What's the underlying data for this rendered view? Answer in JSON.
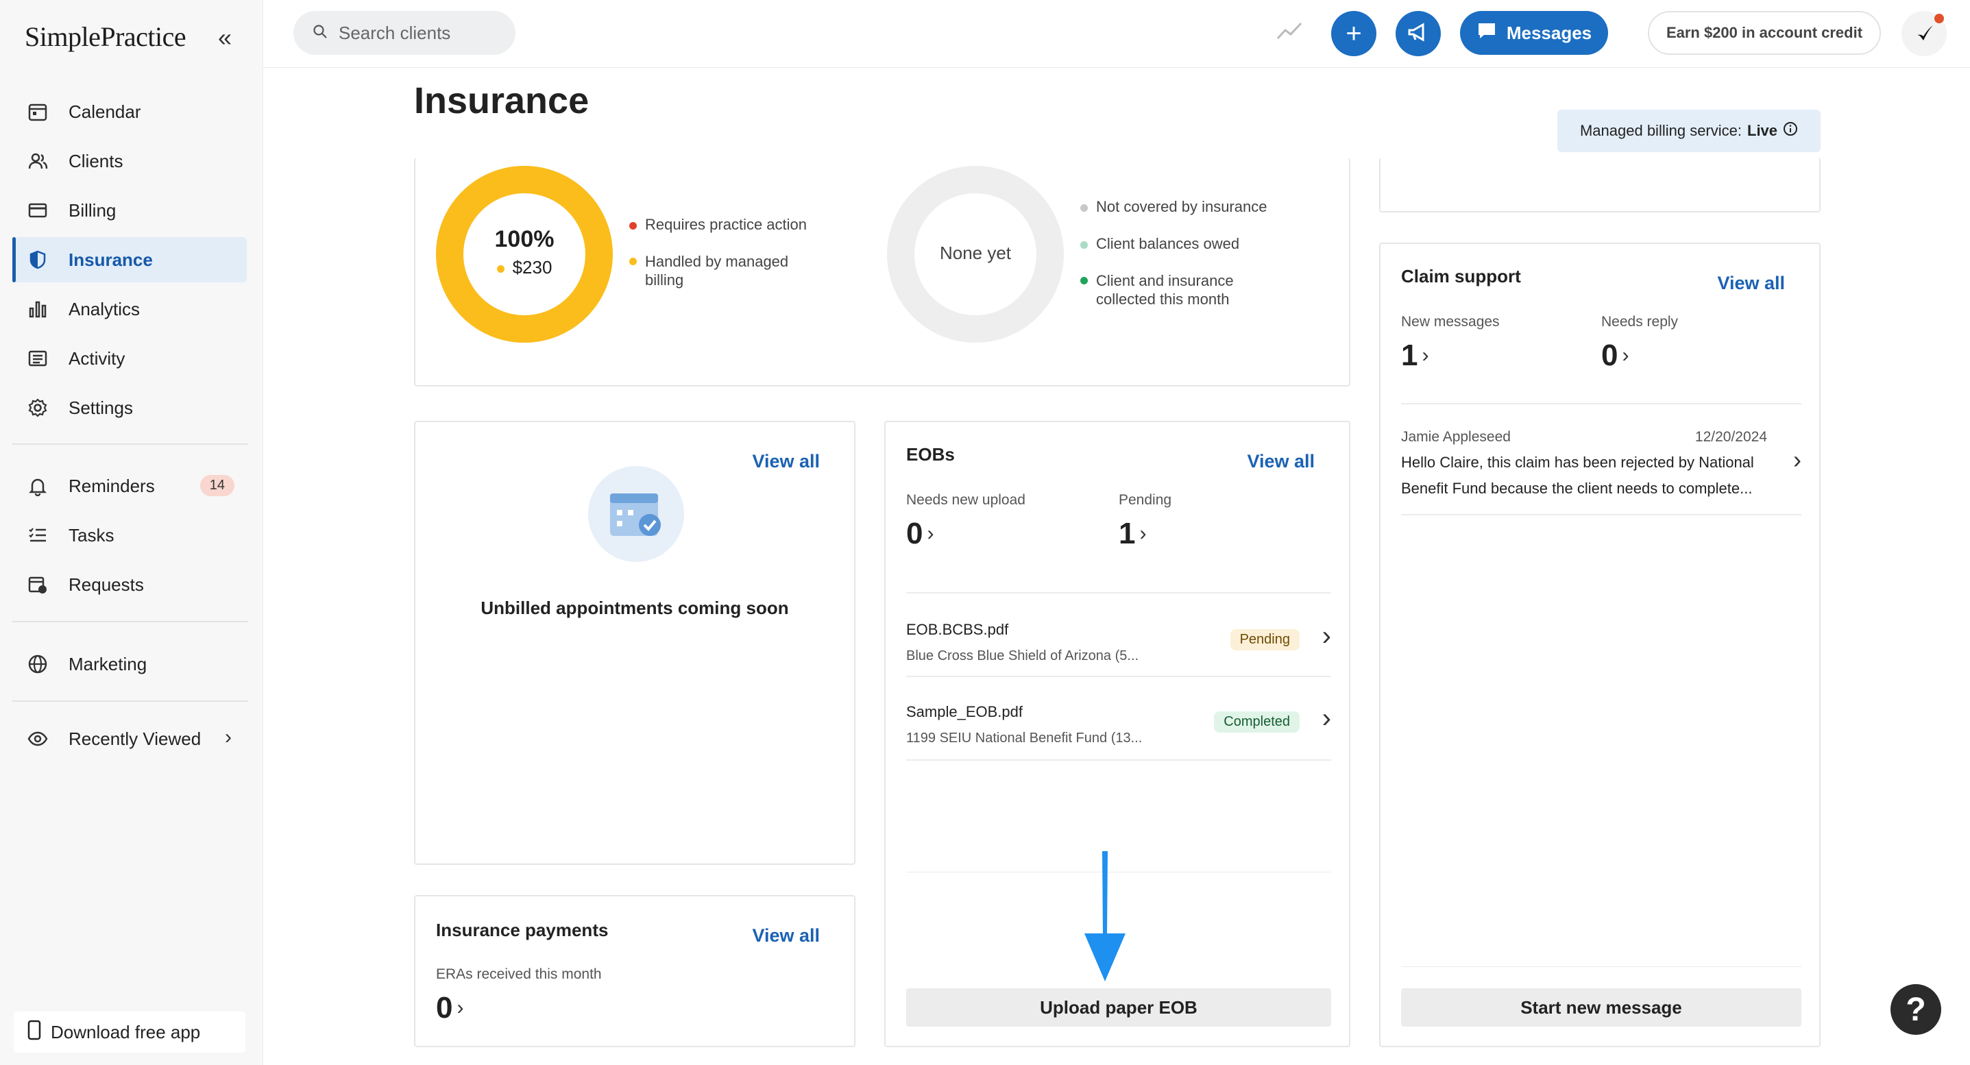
{
  "app": {
    "logo": "SimplePractice"
  },
  "sidebar": {
    "items": [
      {
        "label": "Calendar"
      },
      {
        "label": "Clients"
      },
      {
        "label": "Billing"
      },
      {
        "label": "Insurance"
      },
      {
        "label": "Analytics"
      },
      {
        "label": "Activity"
      },
      {
        "label": "Settings"
      },
      {
        "label": "Reminders",
        "badge": "14"
      },
      {
        "label": "Tasks"
      },
      {
        "label": "Requests"
      },
      {
        "label": "Marketing"
      },
      {
        "label": "Recently Viewed"
      }
    ],
    "download": "Download free app"
  },
  "topbar": {
    "search_placeholder": "Search clients",
    "messages": "Messages",
    "earn": "Earn $200 in account credit"
  },
  "page": {
    "title": "Insurance",
    "managed_label": "Managed billing service:",
    "managed_value": "Live"
  },
  "donut1": {
    "percent": "100%",
    "amount": "$230",
    "fill_fraction": 1.0,
    "color": "#fbbd1c",
    "legend": [
      {
        "label": "Requires practice action",
        "color": "#e0412a"
      },
      {
        "label": "Handled by managed billing",
        "color": "#fbbd1c"
      }
    ]
  },
  "donut2": {
    "center": "None yet",
    "legend": [
      {
        "label": "Not covered by insurance",
        "color": "#c8c8c8"
      },
      {
        "label": "Client balances owed",
        "color": "#a8dcc4"
      },
      {
        "label": "Client and insurance collected this month",
        "color": "#22a35a"
      }
    ]
  },
  "unbilled": {
    "view_all": "View all",
    "message": "Unbilled appointments coming soon"
  },
  "payments": {
    "title": "Insurance payments",
    "view_all": "View all",
    "sub": "ERAs received this month",
    "count": "0"
  },
  "eobs": {
    "title": "EOBs",
    "view_all": "View all",
    "needs_label": "Needs new upload",
    "needs_count": "0",
    "pending_label": "Pending",
    "pending_count": "1",
    "rows": [
      {
        "name": "EOB.BCBS.pdf",
        "payer": "Blue Cross Blue Shield of Arizona (5...",
        "status": "Pending"
      },
      {
        "name": "Sample_EOB.pdf",
        "payer": "1199 SEIU National Benefit Fund (13...",
        "status": "Completed"
      }
    ],
    "upload": "Upload paper EOB"
  },
  "claims": {
    "title": "Claim support",
    "view_all": "View all",
    "new_label": "New messages",
    "new_count": "1",
    "reply_label": "Needs reply",
    "reply_count": "0",
    "message": {
      "author": "Jamie Appleseed",
      "date": "12/20/2024",
      "line1": "Hello Claire, this claim has been rejected by National",
      "line2": "Benefit Fund because the client needs to complete..."
    },
    "start": "Start new message"
  },
  "help": "?"
}
